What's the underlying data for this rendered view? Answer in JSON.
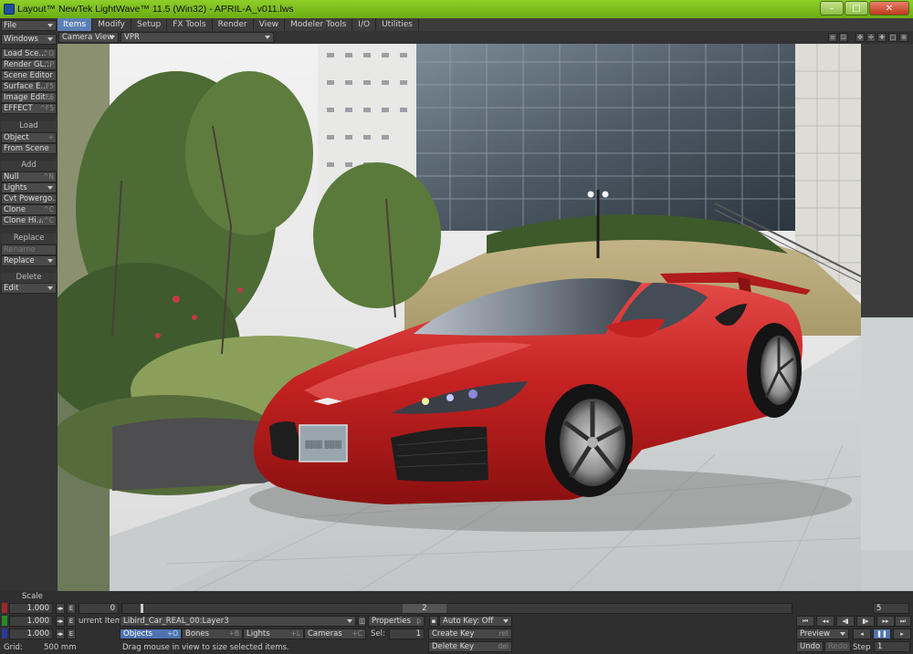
{
  "window": {
    "title": "Layout™ NewTek LightWave™ 11.5 (Win32) - APRIL-A_v011.lws",
    "min_glyph": "–",
    "max_glyph": "□",
    "close_glyph": "✕"
  },
  "tabs": [
    {
      "label": "Items",
      "active": true
    },
    {
      "label": "Modify"
    },
    {
      "label": "Setup"
    },
    {
      "label": "FX Tools"
    },
    {
      "label": "Render"
    },
    {
      "label": "View"
    },
    {
      "label": "Modeler Tools"
    },
    {
      "label": "I/O"
    },
    {
      "label": "Utilities"
    }
  ],
  "sidebar": {
    "file": "File",
    "windows": "Windows",
    "load_scene": {
      "label": "Load Sce...",
      "sc": "^O"
    },
    "render_gl": {
      "label": "Render GL...",
      "sc": "^P"
    },
    "scene_editor": {
      "label": "Scene Editor"
    },
    "surface_editor": {
      "label": "Surface E...",
      "sc": "F5"
    },
    "image_editor": {
      "label": "Image Edit...",
      "sc": "F6"
    },
    "effect": {
      "label": "EFFECT",
      "sc": "^F5"
    },
    "load_header": "Load",
    "object": {
      "label": "Object",
      "sc": "+"
    },
    "from_scene": {
      "label": "From Scene"
    },
    "add_header": "Add",
    "null": {
      "label": "Null",
      "sc": "^N"
    },
    "lights": {
      "label": "Lights"
    },
    "cvt_powergons": {
      "label": "Cvt Powergo..."
    },
    "clone": {
      "label": "Clone",
      "sc": "^C"
    },
    "clone_hierarchy": {
      "label": "Clone Hi...",
      "sc": "+^C"
    },
    "replace_header": "Replace",
    "rename": {
      "label": "Rename"
    },
    "replace": {
      "label": "Replace"
    },
    "delete_header": "Delete",
    "edit": {
      "label": "Edit"
    }
  },
  "viewport_bar": {
    "camera_view": "Camera View",
    "vpr": "VPR"
  },
  "viewport": {
    "plate_text": "▓▓▓ ▓▓▓"
  },
  "bottom": {
    "scale_label": "Scale",
    "scale_values": [
      "1.000",
      "1.000",
      "1.000"
    ],
    "e_label": "E",
    "frame_current": "0",
    "timeline_marker": "2",
    "end_frame": "5",
    "current_item_label": "urrent Item",
    "current_item": "Libird_Car_REAL_00:Layer3",
    "properties": {
      "label": "Properties",
      "sc": "p"
    },
    "auto_key": "Auto Key: Off",
    "objects": {
      "label": "Objects",
      "sc": "+O"
    },
    "bones": {
      "label": "Bones",
      "sc": "+B"
    },
    "lights": {
      "label": "Lights",
      "sc": "+L"
    },
    "cameras": {
      "label": "Cameras",
      "sc": "+C"
    },
    "sel_label": "Sel:",
    "sel_value": "1",
    "create_key": {
      "label": "Create Key",
      "sc": "ret"
    },
    "delete_key": {
      "label": "Delete Key",
      "sc": "del"
    },
    "grid_label": "Grid:",
    "grid_value": "500 mm",
    "status": "Drag mouse in view to size selected items.",
    "preview": "Preview",
    "undo": "Undo",
    "redo": "Redo",
    "step_label": "Step",
    "step_value": "1"
  },
  "colors": {
    "title_bar": "#7cc01e",
    "accent_blue": "#4f73b0",
    "car_red": "#c42222"
  }
}
